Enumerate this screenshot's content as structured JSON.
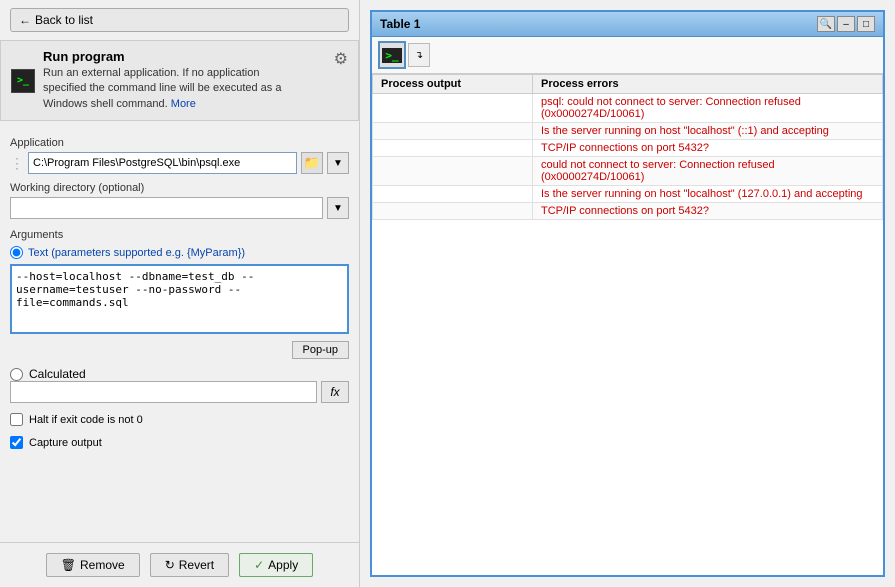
{
  "back_button": "Back to list",
  "section": {
    "title": "Run program",
    "description": "Run an external application. If no application specified the command line will be executed as a Windows shell command.",
    "more_link": "More",
    "icon_label": ">_"
  },
  "application": {
    "label": "Application",
    "value": "C:\\Program Files\\PostgreSQL\\bin\\psql.exe"
  },
  "working_directory": {
    "label": "Working directory (optional)",
    "value": ""
  },
  "arguments": {
    "label": "Arguments",
    "radio_label": "Text (parameters supported e.g. {MyParam})",
    "text_value": "--host=localhost --dbname=test_db --username=testuser --no-password --file=commands.sql",
    "popup_btn": "Pop-up",
    "calc_label": "Calculated",
    "calc_value": "",
    "fx_label": "fx"
  },
  "checkboxes": {
    "halt_label": "Halt if exit code is not 0",
    "halt_checked": false,
    "capture_label": "Capture output",
    "capture_checked": true
  },
  "bottom_buttons": {
    "remove": "Remove",
    "revert": "Revert",
    "apply": "Apply"
  },
  "table_window": {
    "title": "Table 1",
    "toolbar_icon": ">_",
    "columns": [
      "Process output",
      "Process errors"
    ],
    "rows": [
      {
        "output": "",
        "error": "psql: could not connect to server: Connection refused (0x0000274D/10061)"
      },
      {
        "output": "",
        "error": "Is the server running on host \"localhost\" (::1) and accepting"
      },
      {
        "output": "",
        "error": "TCP/IP connections on port 5432?"
      },
      {
        "output": "",
        "error": "could not connect to server: Connection refused (0x0000274D/10061)"
      },
      {
        "output": "",
        "error": "Is the server running on host \"localhost\" (127.0.0.1) and accepting"
      },
      {
        "output": "",
        "error": "TCP/IP connections on port 5432?"
      }
    ]
  }
}
